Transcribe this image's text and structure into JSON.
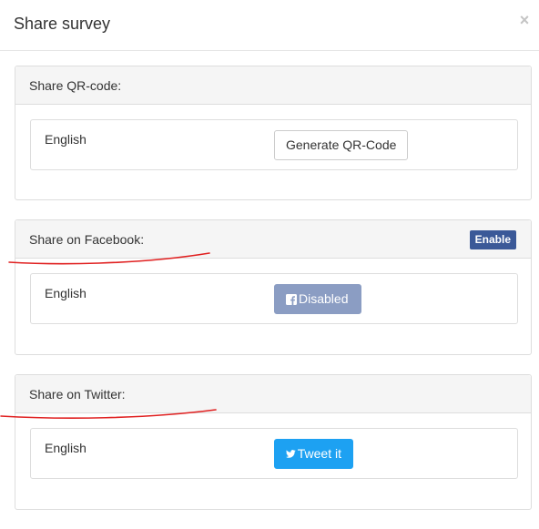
{
  "modal": {
    "title": "Share survey",
    "close_label": "×"
  },
  "qr_panel": {
    "heading": "Share QR-code:",
    "language": "English",
    "button_label": "Generate QR-Code"
  },
  "facebook_panel": {
    "heading": "Share on Facebook:",
    "enable_label": "Enable",
    "language": "English",
    "button_label": "Disabled",
    "button_icon": "facebook-icon"
  },
  "twitter_panel": {
    "heading": "Share on Twitter:",
    "language": "English",
    "button_label": "Tweet it",
    "button_icon": "twitter-bird-icon"
  },
  "colors": {
    "facebook_enable": "#3b5998",
    "facebook_disabled": "#8b9dc3",
    "twitter": "#1da1f2",
    "annotation": "#e02020"
  }
}
